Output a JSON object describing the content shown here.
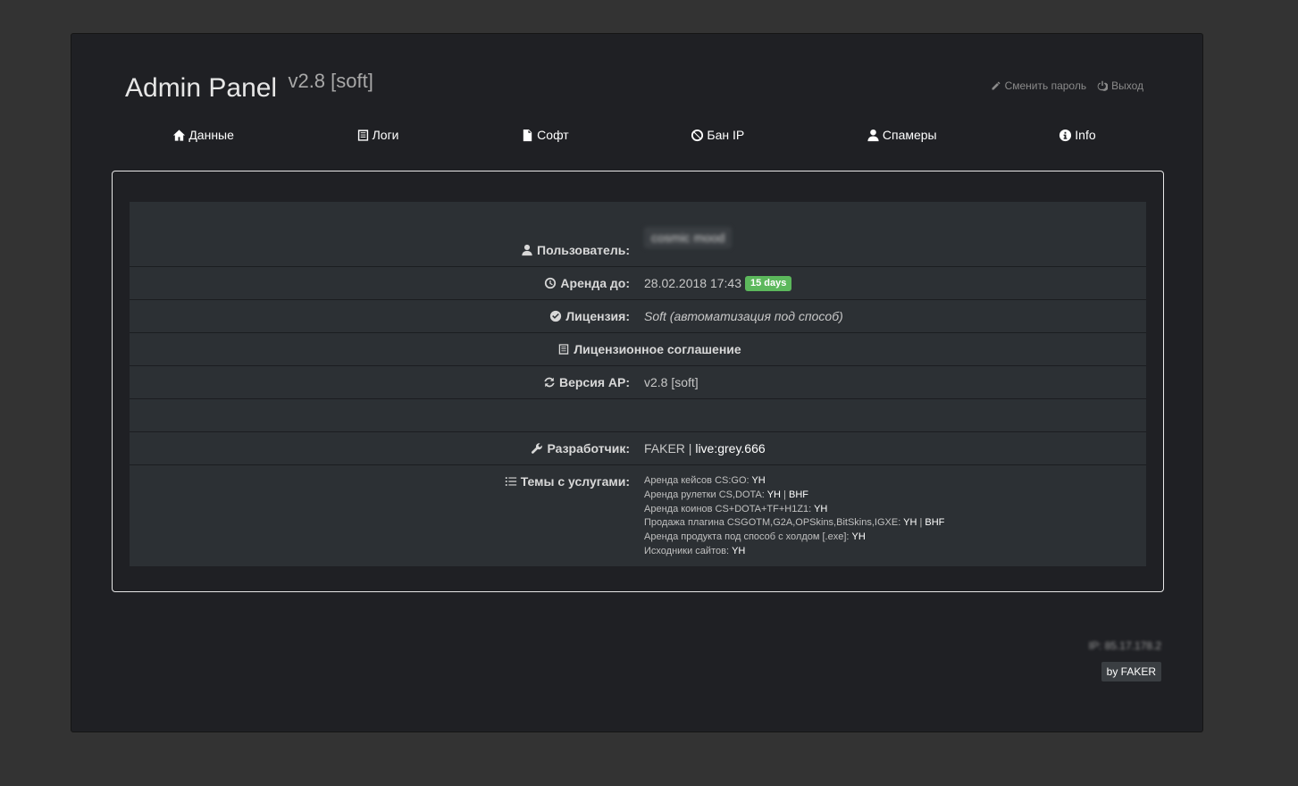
{
  "header": {
    "title": "Admin Panel",
    "version": "v2.8 [soft]",
    "change_password": "Сменить пароль",
    "logout": "Выход"
  },
  "nav": [
    {
      "label": "Данные",
      "icon": "home-icon"
    },
    {
      "label": "Логи",
      "icon": "list-icon"
    },
    {
      "label": "Софт",
      "icon": "file-icon"
    },
    {
      "label": "Бан IP",
      "icon": "ban-icon"
    },
    {
      "label": "Спамеры",
      "icon": "user-icon"
    },
    {
      "label": "Info",
      "icon": "info-icon"
    }
  ],
  "info": {
    "user_label": "Пользователь:",
    "user_value": "cosmic mood",
    "rent_label": "Аренда до:",
    "rent_value": "28.02.2018 17:43",
    "rent_badge": "15 days",
    "license_label": "Лицензия:",
    "license_value": "Soft (автоматизация под способ)",
    "agreement_label": "Лицензионное соглашение",
    "ap_version_label": "Версия AP:",
    "ap_version_value": "v2.8 [soft]",
    "developer_label": "Разработчик:",
    "developer_name": "FAKER",
    "developer_sep": " | ",
    "developer_contact": "live:grey.666",
    "services_label": "Темы с услугами:",
    "services": [
      {
        "text": "Аренда кейсов CS:GO: ",
        "links": [
          "YH"
        ]
      },
      {
        "text": "Аренда рулетки CS,DOTA: ",
        "links": [
          "YH",
          "BHF"
        ]
      },
      {
        "text": "Аренда коинов CS+DOTA+TF+H1Z1: ",
        "links": [
          "YH"
        ]
      },
      {
        "text": "Продажа плагина CSGOTM,G2A,OPSkins,BitSkins,IGXE: ",
        "links": [
          "YH",
          "BHF"
        ]
      },
      {
        "text": "Аренда продукта под способ с холдом [.exe]: ",
        "links": [
          "YH"
        ]
      },
      {
        "text": "Исходники сайтов: ",
        "links": [
          "YH"
        ]
      }
    ]
  },
  "footer": {
    "ip": "IP: 85.17.178.2",
    "by": "by FAKER"
  },
  "colors": {
    "page_bg": "#333333",
    "panel_bg": "#1f2024",
    "table_bg": "#2c3034",
    "badge_green": "#5cb85c"
  }
}
